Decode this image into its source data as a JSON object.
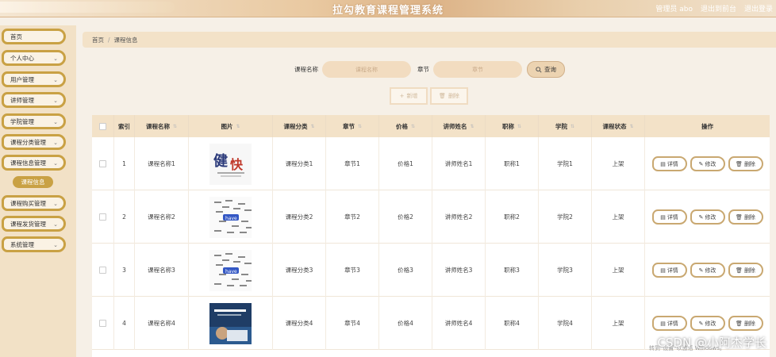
{
  "header": {
    "title": "拉勾教育课程管理系统",
    "links": [
      "管理员 abo",
      "退出到前台",
      "退出登录"
    ]
  },
  "sidebar": {
    "items": [
      {
        "label": "首页",
        "has_children": false
      },
      {
        "label": "个人中心",
        "has_children": true
      },
      {
        "label": "用户管理",
        "has_children": true
      },
      {
        "label": "讲师管理",
        "has_children": true
      },
      {
        "label": "学院管理",
        "has_children": true
      },
      {
        "label": "课程分类管理",
        "has_children": true
      },
      {
        "label": "课程信息管理",
        "has_children": true
      },
      {
        "label": "课程购买管理",
        "has_children": true
      },
      {
        "label": "课程发货管理",
        "has_children": true
      },
      {
        "label": "系统管理",
        "has_children": true
      }
    ],
    "active_sub": "课程信息"
  },
  "breadcrumb": {
    "home": "首页",
    "sep": "/",
    "current": "课程信息"
  },
  "search": {
    "course_label": "课程名称",
    "course_placeholder": "课程名称",
    "chapter_label": "章节",
    "chapter_placeholder": "章节",
    "button": "查询"
  },
  "actions": {
    "add": "新增",
    "delete": "删除"
  },
  "table": {
    "headers": [
      "索引",
      "课程名称",
      "图片",
      "课程分类",
      "章节",
      "价格",
      "讲师姓名",
      "职称",
      "学院",
      "课程状态",
      "操作"
    ],
    "rows": [
      {
        "index": "1",
        "name": "课程名称1",
        "category": "课程分类1",
        "chapter": "章节1",
        "price": "价格1",
        "teacher": "讲师姓名1",
        "title": "职称1",
        "college": "学院1",
        "status": "上架",
        "img": "calligraphy"
      },
      {
        "index": "2",
        "name": "课程名称2",
        "category": "课程分类2",
        "chapter": "章节2",
        "price": "价格2",
        "teacher": "讲师姓名2",
        "title": "职称2",
        "college": "学院2",
        "status": "上架",
        "img": "wordcloud"
      },
      {
        "index": "3",
        "name": "课程名称3",
        "category": "课程分类3",
        "chapter": "章节3",
        "price": "价格3",
        "teacher": "讲师姓名3",
        "title": "职称3",
        "college": "学院3",
        "status": "上架",
        "img": "wordcloud"
      },
      {
        "index": "4",
        "name": "课程名称4",
        "category": "课程分类4",
        "chapter": "章节4",
        "price": "价格4",
        "teacher": "讲师姓名4",
        "title": "职称4",
        "college": "学院4",
        "status": "上架",
        "img": "business"
      }
    ],
    "ops": {
      "detail": "详情",
      "edit": "修改",
      "delete": "删除"
    }
  },
  "overlay": {
    "watermark": "CSDN @小阿杰学长",
    "windows_note": "转到\"设置\"以激活 Windows。"
  }
}
